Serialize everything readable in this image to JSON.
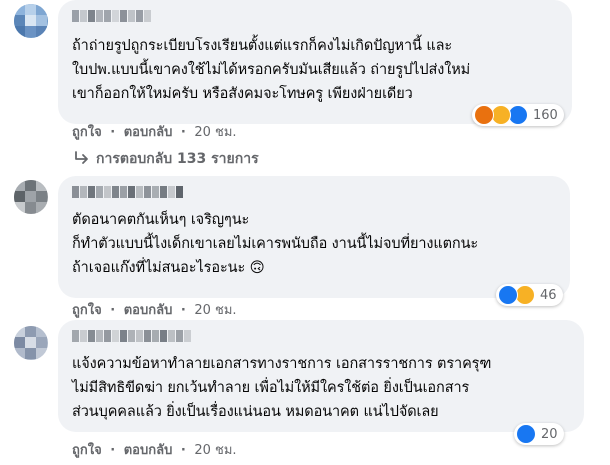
{
  "comments": [
    {
      "name": "",
      "lines": [
        "ถ้าถ่ายรูปถูกระเบียบโรงเรียนตั้งแต่แรกก็คงไม่เกิดปัญหานี้ และ",
        "ใบปพ.แบบนี้เขาคงใช้ไม่ได้หรอกครับมันเสียแล้ว ถ่ายรูปไปส่งใหม่",
        "เขาก็ออกให้ใหม่ครับ หรือสังคมจะโทษครู เพียงฝ่ายเดียว"
      ],
      "like_label": "ถูกใจ",
      "reply_label": "ตอบกลับ",
      "time": "20 ชม.",
      "reaction_count": "160",
      "reactions": [
        "angry",
        "haha",
        "like"
      ],
      "replies_label": "การตอบกลับ 133 รายการ"
    },
    {
      "name": "",
      "lines": [
        "ตัดอนาคตกันเห็นๆ เจริญๆนะ",
        "ก็ทำตัวแบบนี้ไงเด็กเขาเลยไม่เคารพนับถือ งานนี้ไม่จบที่ยางแตกนะ",
        "ถ้าเจอแก๊งที่ไม่สนอะไรอะนะ 🙃"
      ],
      "like_label": "ถูกใจ",
      "reply_label": "ตอบกลับ",
      "time": "20 ชม.",
      "reaction_count": "46",
      "reactions": [
        "like",
        "haha"
      ]
    },
    {
      "name": "",
      "lines": [
        "แจ้งความข้อหาทำลายเอกสารทางราชการ เอกสารราชการ ตราครุฑ",
        "ไม่มีสิทธิขีดฆ่า ยกเว้นทำลาย เพื่อไม่ให้มีใครใช้ต่อ ยิ่งเป็นเอกสาร",
        "ส่วนบุคคลแล้ว ยิ่งเป็นเรื่องแน่นอน หมดอนาคต แน่ไปจัดเลย"
      ],
      "like_label": "ถูกใจ",
      "reply_label": "ตอบกลับ",
      "time": "20 ชม.",
      "reaction_count": "20",
      "reactions": [
        "like"
      ]
    }
  ],
  "separator": "·",
  "colors": {
    "bubble": "#f0f2f5",
    "meta_text": "#65676b",
    "like_blue": "#1877f2",
    "haha_yellow": "#f7b125",
    "angry_red": "#e9710f"
  },
  "icons": {
    "replies_arrow": "reply-arrow-icon"
  }
}
